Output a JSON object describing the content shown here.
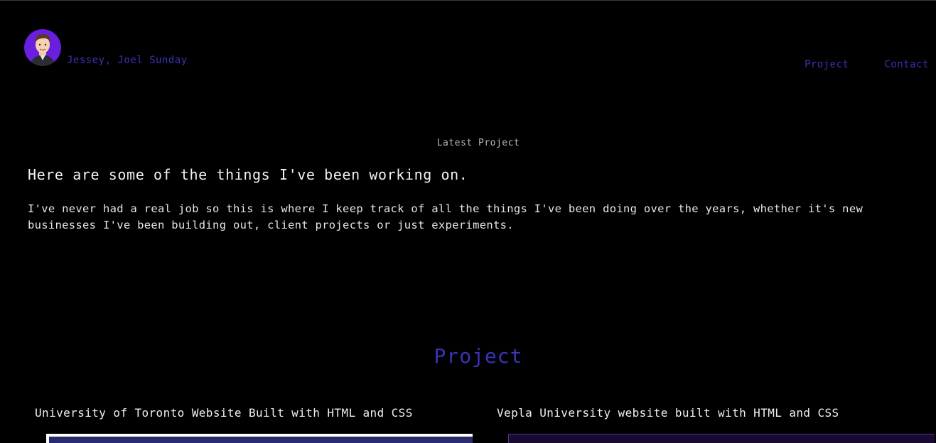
{
  "header": {
    "brand_name": "Jessey, Joel Sunday",
    "nav": [
      {
        "label": "Project"
      },
      {
        "label": "Contact"
      }
    ]
  },
  "hero": {
    "eyebrow": "Latest Project",
    "headline": "Here are some of the things I've been working on.",
    "intro": "I've never had a real job so this is where I keep track of all the things I've been doing over the years, whether it's new businesses I've been building out, client projects or just experiments."
  },
  "projects": {
    "title": "Project",
    "items": [
      {
        "title": "University of Toronto Website Built with HTML and CSS"
      },
      {
        "title": "Vepla University website built with HTML and CSS"
      }
    ]
  },
  "colors": {
    "background": "#000000",
    "accent": "#3b33b8",
    "text": "#e6e6e6",
    "avatar_bg": "#6a1fe0"
  }
}
